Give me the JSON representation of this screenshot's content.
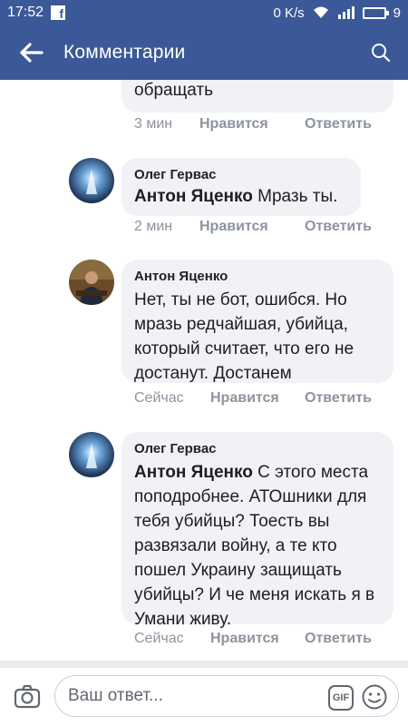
{
  "status_bar": {
    "time": "17:52",
    "network_speed": "0 K/s",
    "battery_level": "9"
  },
  "header": {
    "title": "Комментарии"
  },
  "comments": [
    {
      "text": "обращать",
      "time": "3 мин",
      "like_label": "Нравится",
      "reply_label": "Ответить"
    },
    {
      "author": "Олег Гервас",
      "mention": "Антон Яценко",
      "text": " Мразь ты.",
      "time": "2 мин",
      "like_label": "Нравится",
      "reply_label": "Ответить"
    },
    {
      "author": "Антон Яценко",
      "text": "Нет, ты не бот, ошибся. Но мразь редчайшая, убийца, который считает, что его не достанут. Достанем",
      "time": "Сейчас",
      "like_label": "Нравится",
      "reply_label": "Ответить"
    },
    {
      "author": "Олег Гервас",
      "mention": "Антон Яценко",
      "text": " С этого места поподробнее. АТОшники для тебя убийцы?  Тоесть вы развязали войну, а те кто пошел Украину защищать убийцы?  И че меня искать я в Умани живу.",
      "time": "Сейчас",
      "like_label": "Нравится",
      "reply_label": "Ответить"
    }
  ],
  "composer": {
    "placeholder": "Ваш ответ...",
    "gif_label": "GIF"
  },
  "icons": {
    "back": "arrow-left-icon",
    "search": "search-icon",
    "camera": "camera-icon",
    "gif": "gif-icon",
    "emoji": "smiley-icon"
  },
  "colors": {
    "header": "#3b5998",
    "bubble": "#f1f2f6",
    "meta_text": "#8d949e"
  }
}
